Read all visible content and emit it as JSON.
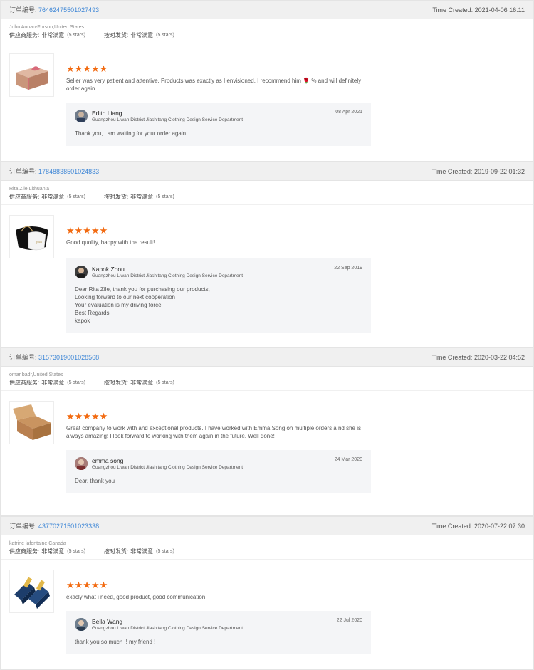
{
  "labels": {
    "order_prefix": "订单编号:",
    "time_prefix": "Time Created:",
    "supplier_service": "供应商服务:",
    "on_time_delivery": "按时发货:",
    "very_satisfied": "非常满意",
    "five_stars": "(5 stars)"
  },
  "colors": {
    "accent_link": "#3d86d6",
    "stars": "#f26a10"
  },
  "reviews": [
    {
      "order_id": "76462475501027493",
      "time_created": "2021-04-06 16:11",
      "buyer": "John Annan-Forson,United States",
      "stars": "★★★★★",
      "comment": "Seller was very patient and attentive. Products was exactly as I envisioned. I recommend him 🌹 % and will definitely order again.",
      "product_icon": "gift-box-icon",
      "reply": {
        "name": "Edith Liang",
        "dept": "Guangzhou Liwan District Jiashitang Clothing Design Service Department",
        "date": "08 Apr 2021",
        "text": "Thank you, i am waiting for your order again."
      }
    },
    {
      "order_id": "17848838501024833",
      "time_created": "2019-09-22 01:32",
      "buyer": "Rita Zile,Lithuania",
      "stars": "★★★★★",
      "comment": "Good quolity, happy with the result!",
      "product_icon": "pillow-box-icon",
      "reply": {
        "name": "Kapok Zhou",
        "dept": "Guangzhou Liwan District Jiashitang Clothing Design Service Department",
        "date": "22 Sep 2019",
        "text": "Dear Rita Zile, thank you for purchasing our products,\nLooking forward to our next cooperation\nYour evaluation is my driving force!\nBest Regards\nkapok"
      }
    },
    {
      "order_id": "31573019001028568",
      "time_created": "2020-03-22 04:52",
      "buyer": "omar badr,United States",
      "stars": "★★★★★",
      "comment": "Great company to work with and exceptional products. I have worked with Emma Song on multiple orders a nd she is always amazing! I look forward to working with them again in the future. Well done!",
      "product_icon": "kraft-box-icon",
      "reply": {
        "name": "emma song",
        "dept": "Guangzhou Liwan District Jiashitang Clothing Design Service Department",
        "date": "24 Mar 2020",
        "text": "Dear, thank you"
      }
    },
    {
      "order_id": "43770271501023338",
      "time_created": "2020-07-22 07:30",
      "buyer": "katrine lafontaine,Canada",
      "stars": "★★★★★",
      "comment": "exacly what i need, good product, good communication",
      "product_icon": "blue-boxes-icon",
      "reply": {
        "name": "Bella Wang",
        "dept": "Guangzhou Liwan District Jiashitang Clothing Design Service Department",
        "date": "22 Jul 2020",
        "text": "thank you so much !! my friend !"
      }
    }
  ]
}
